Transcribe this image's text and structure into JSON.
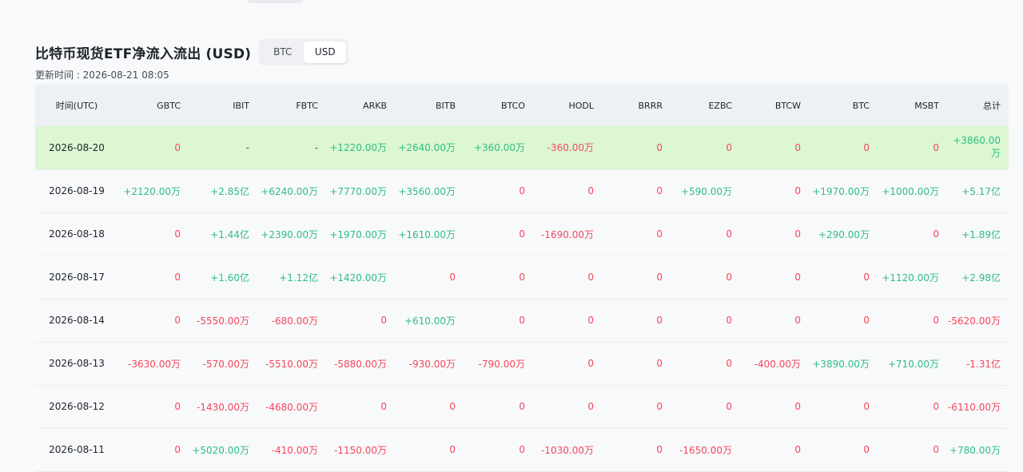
{
  "header": {
    "title": "比特币现货ETF净流入流出 (USD)",
    "toggle": [
      "BTC",
      "USD"
    ],
    "active": "USD",
    "updated": "更新时间 : 2026-08-21 08:05"
  },
  "colors": {
    "positive": "#2ebd85",
    "negative": "#f6465d",
    "highlight": "#dcf7d2"
  },
  "table": {
    "columns": [
      "时间(UTC)",
      "GBTC",
      "IBIT",
      "FBTC",
      "ARKB",
      "BITB",
      "BTCO",
      "HODL",
      "BRRR",
      "EZBC",
      "BTCW",
      "BTC",
      "MSBT",
      "总计"
    ],
    "rows": [
      [
        "2026-08-20",
        "0",
        "-",
        "-",
        "+1220.00万",
        "+2640.00万",
        "+360.00万",
        "-360.00万",
        "0",
        "0",
        "0",
        "0",
        "0",
        "+3860.00万"
      ],
      [
        "2026-08-19",
        "+2120.00万",
        "+2.85亿",
        "+6240.00万",
        "+7770.00万",
        "+3560.00万",
        "0",
        "0",
        "0",
        "+590.00万",
        "0",
        "+1970.00万",
        "+1000.00万",
        "+5.17亿"
      ],
      [
        "2026-08-18",
        "0",
        "+1.44亿",
        "+2390.00万",
        "+1970.00万",
        "+1610.00万",
        "0",
        "-1690.00万",
        "0",
        "0",
        "0",
        "+290.00万",
        "0",
        "+1.89亿"
      ],
      [
        "2026-08-17",
        "0",
        "+1.60亿",
        "+1.12亿",
        "+1420.00万",
        "0",
        "0",
        "0",
        "0",
        "0",
        "0",
        "0",
        "+1120.00万",
        "+2.98亿"
      ],
      [
        "2026-08-14",
        "0",
        "-5550.00万",
        "-680.00万",
        "0",
        "+610.00万",
        "0",
        "0",
        "0",
        "0",
        "0",
        "0",
        "0",
        "-5620.00万"
      ],
      [
        "2026-08-13",
        "-3630.00万",
        "-570.00万",
        "-5510.00万",
        "-5880.00万",
        "-930.00万",
        "-790.00万",
        "0",
        "0",
        "0",
        "-400.00万",
        "+3890.00万",
        "+710.00万",
        "-1.31亿"
      ],
      [
        "2026-08-12",
        "0",
        "-1430.00万",
        "-4680.00万",
        "0",
        "0",
        "0",
        "0",
        "0",
        "0",
        "0",
        "0",
        "0",
        "-6110.00万"
      ],
      [
        "2026-08-11",
        "0",
        "+5020.00万",
        "-410.00万",
        "-1150.00万",
        "0",
        "0",
        "-1030.00万",
        "0",
        "-1650.00万",
        "0",
        "0",
        "0",
        "+780.00万"
      ]
    ]
  }
}
